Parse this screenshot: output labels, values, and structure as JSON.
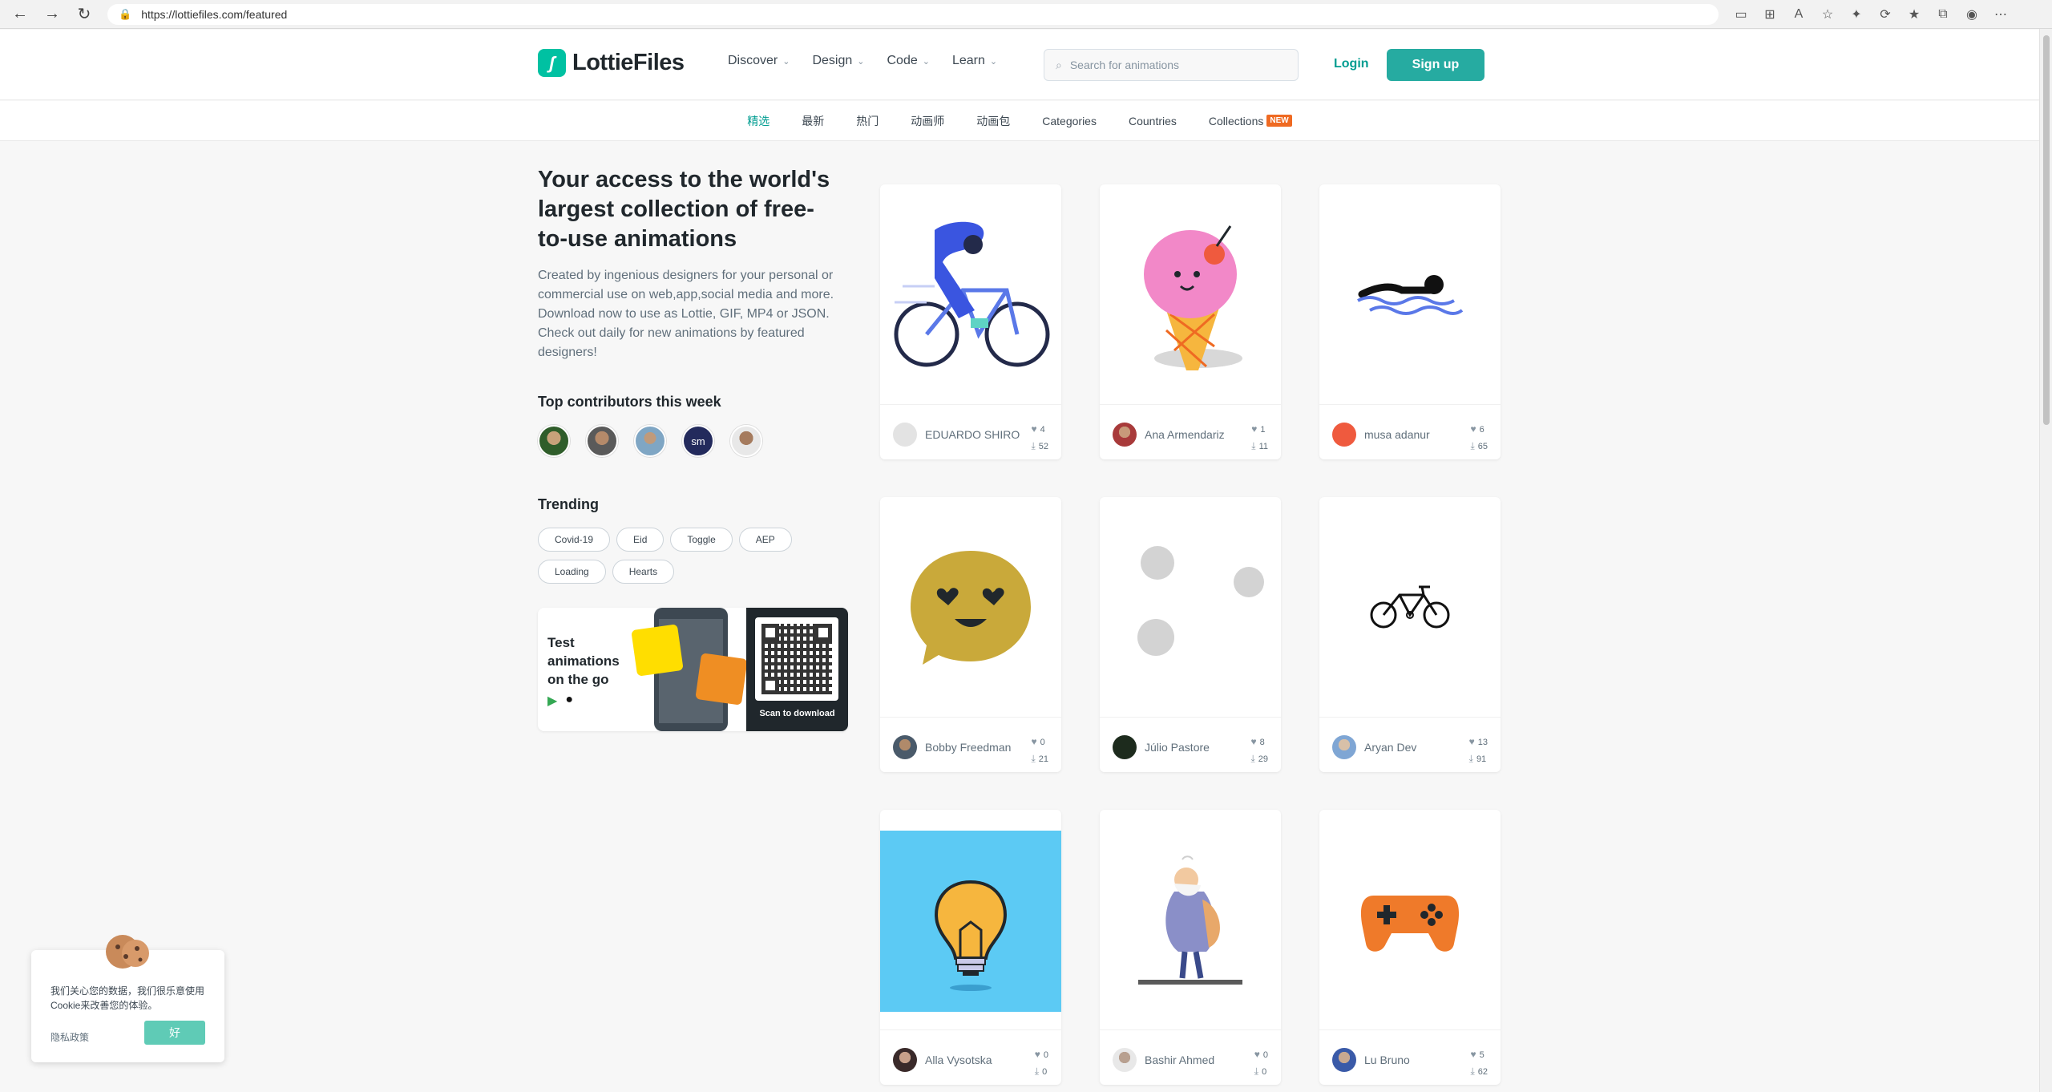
{
  "browser": {
    "url": "https://lottiefiles.com/featured"
  },
  "header": {
    "logo_text": "LottieFiles",
    "nav": [
      {
        "label": "Discover"
      },
      {
        "label": "Design"
      },
      {
        "label": "Code"
      },
      {
        "label": "Learn"
      }
    ],
    "search_placeholder": "Search for animations",
    "login_label": "Login",
    "signup_label": "Sign up"
  },
  "subnav": {
    "items": [
      "精选",
      "最新",
      "热门",
      "动画师",
      "动画包",
      "Categories",
      "Countries",
      "Collections"
    ],
    "active_index": 0,
    "new_badge": "NEW"
  },
  "hero": {
    "title": "Your access to the world's largest collection of free-to-use animations",
    "description": "Created by ingenious designers for your personal or commercial use on web,app,social media and more. Download now to use as Lottie, GIF, MP4 or JSON. Check out daily for new animations by featured designers!"
  },
  "contributors": {
    "title": "Top contributors this week"
  },
  "trending": {
    "title": "Trending",
    "tags": [
      "Covid-19",
      "Eid",
      "Toggle",
      "AEP",
      "Loading",
      "Hearts"
    ]
  },
  "promo": {
    "text": "Test animations on the go",
    "qr_caption": "Scan to download"
  },
  "cards": [
    {
      "author": "EDUARDO SHIRO",
      "likes": "4",
      "downloads": "52"
    },
    {
      "author": "Ana Armendariz",
      "likes": "1",
      "downloads": "11"
    },
    {
      "author": "musa adanur",
      "likes": "6",
      "downloads": "65"
    },
    {
      "author": "Bobby Freedman",
      "likes": "0",
      "downloads": "21"
    },
    {
      "author": "Júlio Pastore",
      "likes": "8",
      "downloads": "29"
    },
    {
      "author": "Aryan Dev",
      "likes": "13",
      "downloads": "91"
    },
    {
      "author": "Alla Vysotska",
      "likes": "0",
      "downloads": "0"
    },
    {
      "author": "Bashir Ahmed",
      "likes": "0",
      "downloads": "0"
    },
    {
      "author": "Lu Bruno",
      "likes": "5",
      "downloads": "62"
    }
  ],
  "cookie": {
    "text": "我们关心您的数据，我们很乐意使用Cookie来改善您的体验。",
    "privacy_link": "隐私政策",
    "ok_label": "好"
  },
  "colors": {
    "brand": "#019d91",
    "logo": "#00c1a2",
    "badge": "#ef6a22"
  }
}
